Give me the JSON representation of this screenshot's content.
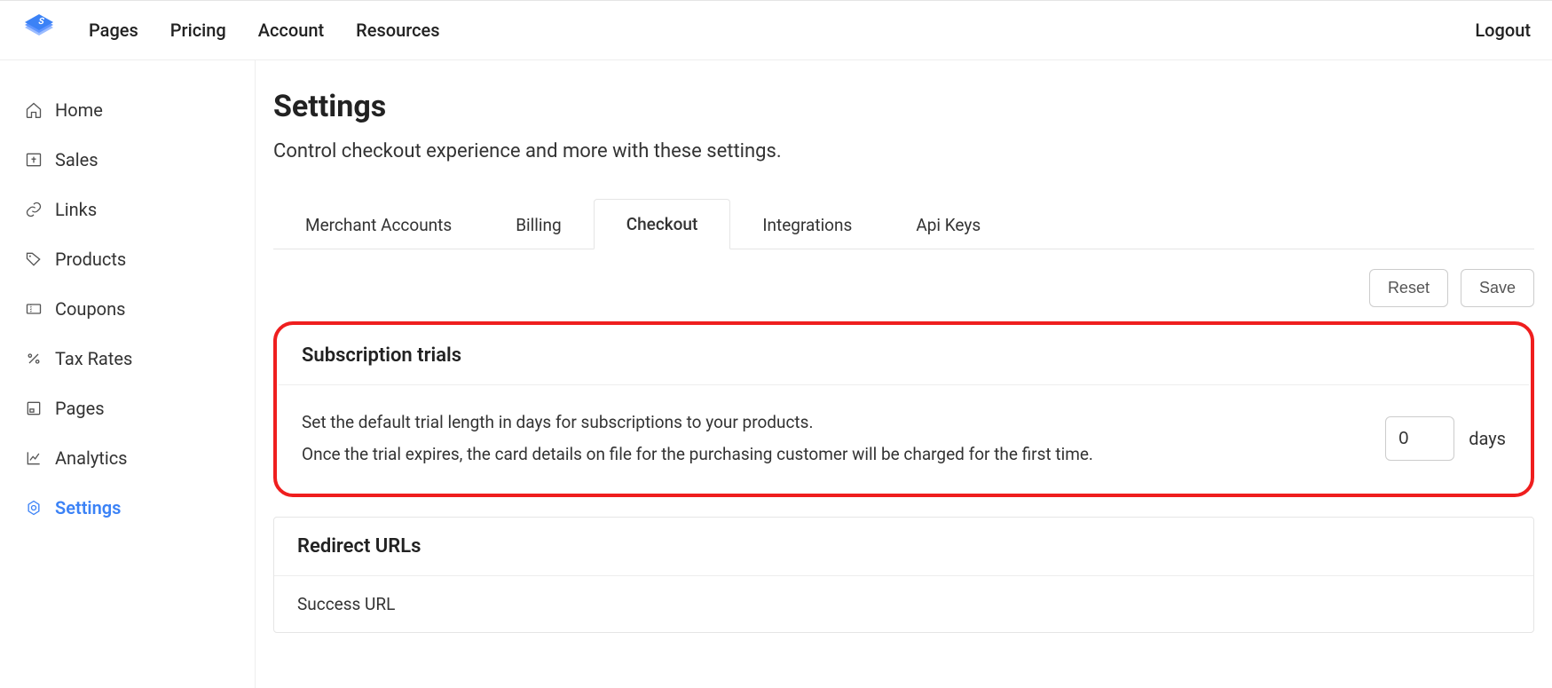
{
  "topnav": {
    "items": [
      "Pages",
      "Pricing",
      "Account",
      "Resources"
    ],
    "logout": "Logout"
  },
  "sidebar": {
    "items": [
      {
        "label": "Home"
      },
      {
        "label": "Sales"
      },
      {
        "label": "Links"
      },
      {
        "label": "Products"
      },
      {
        "label": "Coupons"
      },
      {
        "label": "Tax Rates"
      },
      {
        "label": "Pages"
      },
      {
        "label": "Analytics"
      },
      {
        "label": "Settings",
        "active": true
      }
    ]
  },
  "page": {
    "title": "Settings",
    "subtitle": "Control checkout experience and more with these settings."
  },
  "tabs": {
    "items": [
      "Merchant Accounts",
      "Billing",
      "Checkout",
      "Integrations",
      "Api Keys"
    ],
    "active": "Checkout"
  },
  "actions": {
    "reset": "Reset",
    "save": "Save"
  },
  "trials_card": {
    "title": "Subscription trials",
    "line1": "Set the default trial length in days for subscriptions to your products.",
    "line2": "Once the trial expires, the card details on file for the purchasing customer will be charged for the first time.",
    "value": "0",
    "unit": "days"
  },
  "redirect_card": {
    "title": "Redirect URLs",
    "success_label": "Success URL"
  }
}
